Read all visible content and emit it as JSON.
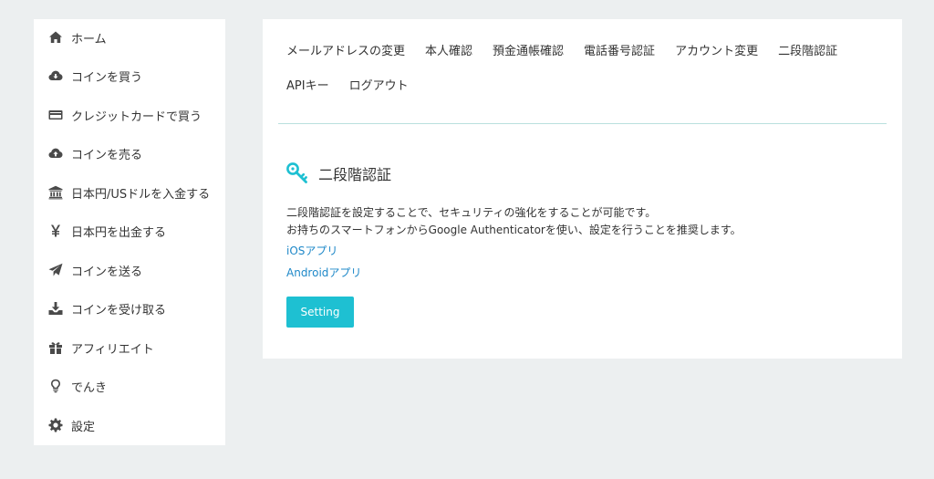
{
  "sidebar": {
    "items": [
      {
        "icon": "home-icon",
        "label": "ホーム"
      },
      {
        "icon": "cloud-download-icon",
        "label": "コインを買う"
      },
      {
        "icon": "credit-card-icon",
        "label": "クレジットカードで買う"
      },
      {
        "icon": "cloud-upload-icon",
        "label": "コインを売る"
      },
      {
        "icon": "bank-icon",
        "label": "日本円/USドルを入金する"
      },
      {
        "icon": "yen-icon",
        "label": "日本円を出金する"
      },
      {
        "icon": "paper-plane-icon",
        "label": "コインを送る"
      },
      {
        "icon": "download-icon",
        "label": "コインを受け取る"
      },
      {
        "icon": "gift-icon",
        "label": "アフィリエイト"
      },
      {
        "icon": "lightbulb-icon",
        "label": "でんき"
      },
      {
        "icon": "gear-icon",
        "label": "設定"
      }
    ]
  },
  "tabs": {
    "row1": [
      "メールアドレスの変更",
      "本人確認",
      "預金通帳確認",
      "電話番号認証",
      "アカウント変更",
      "二段階認証"
    ],
    "row2": [
      "APIキー",
      "ログアウト"
    ]
  },
  "section": {
    "icon": "key-icon",
    "title": "二段階認証",
    "desc_line1": "二段階認証を設定することで、セキュリティの強化をすることが可能です。",
    "desc_line2": "お持ちのスマートフォンからGoogle Authenticatorを使い、設定を行うことを推奨します。",
    "link_ios": "iOSアプリ",
    "link_android": "Androidアプリ",
    "button_label": "Setting"
  },
  "colors": {
    "accent": "#1ec0d2",
    "link": "#1e88c8",
    "background": "#eceff0"
  }
}
